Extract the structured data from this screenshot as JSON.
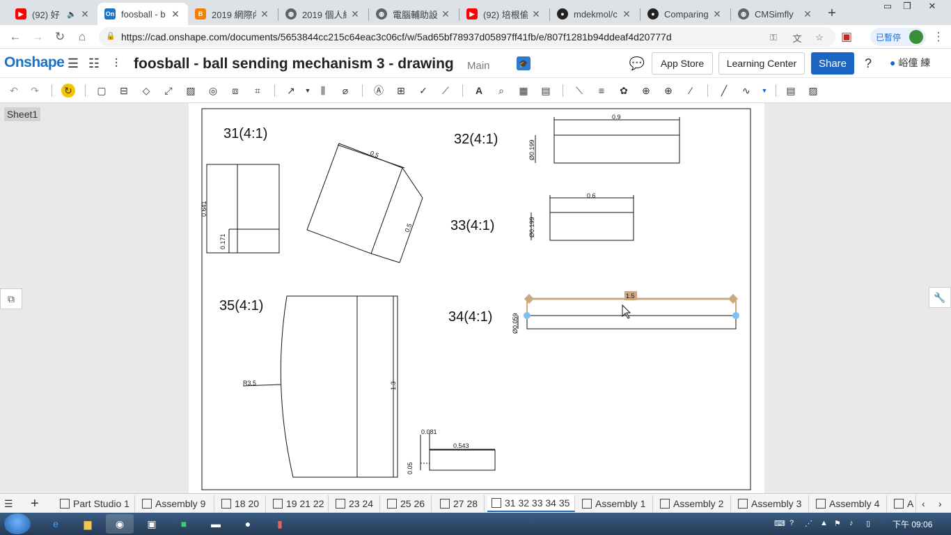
{
  "browser": {
    "tabs": [
      {
        "title": "(92) 好",
        "icon": "youtube-icon",
        "color": "#ff0000"
      },
      {
        "title": "foosball - b",
        "icon": "onshape-icon",
        "color": "#1a72c9",
        "active": true
      },
      {
        "title": "2019 網際內",
        "icon": "blogger-icon",
        "color": "#f57d00"
      },
      {
        "title": "2019 個人網",
        "icon": "globe-icon",
        "color": "#5f6368"
      },
      {
        "title": "電腦輔助設",
        "icon": "globe-icon",
        "color": "#5f6368"
      },
      {
        "title": "(92) 培根偷",
        "icon": "youtube-icon",
        "color": "#ff0000"
      },
      {
        "title": "mdekmol/c",
        "icon": "github-icon",
        "color": "#222222"
      },
      {
        "title": "Comparing",
        "icon": "github-icon",
        "color": "#222222"
      },
      {
        "title": "CMSimfly",
        "icon": "globe-icon",
        "color": "#5f6368"
      }
    ],
    "url": "https://cad.onshape.com/documents/5653844cc215c64eac3c06cf/w/5ad65bf78937d05897ff41fb/e/807f1281b94ddeaf4d20777d",
    "profile_label": "已暫停"
  },
  "onshape": {
    "logo": "Onshape",
    "doc_title": "foosball - ball sending mechanism 3 - drawing",
    "branch": "Main",
    "app_store": "App Store",
    "learning_center": "Learning Center",
    "share": "Share",
    "user": "峪僮 練"
  },
  "drawing": {
    "sheet_tab": "Sheet1",
    "views": {
      "v31": "31(4:1)",
      "v32": "32(4:1)",
      "v33": "33(4:1)",
      "v34": "34(4:1)",
      "v35": "35(4:1)"
    },
    "dims": {
      "d31_a": "0.641",
      "d31_b": "0.171",
      "d31_c": "0.5",
      "d31_d": "0.5",
      "d32_len": "0.9",
      "d32_dia": "Ø0.199",
      "d33_len": "0.6",
      "d33_dia": "Ø0.199",
      "d34_len": "1.5",
      "d34_dia": "Ø0.059",
      "d35_r": "R3.5",
      "d35_h": "1.3",
      "dx_a": "0.081",
      "dx_b": "0.543",
      "dx_c": "0.05"
    }
  },
  "bottom_tabs": [
    {
      "label": "Part Studio 1"
    },
    {
      "label": "Assembly 9"
    },
    {
      "label": "18 20"
    },
    {
      "label": "19 21 22"
    },
    {
      "label": "23 24"
    },
    {
      "label": "25 26"
    },
    {
      "label": "27 28"
    },
    {
      "label": "31 32 33 34 35",
      "active": true
    },
    {
      "label": "Assembly 1"
    },
    {
      "label": "Assembly 2"
    },
    {
      "label": "Assembly 3"
    },
    {
      "label": "Assembly 4"
    },
    {
      "label": "A"
    }
  ],
  "taskbar": {
    "clock": "下午 09:06"
  }
}
